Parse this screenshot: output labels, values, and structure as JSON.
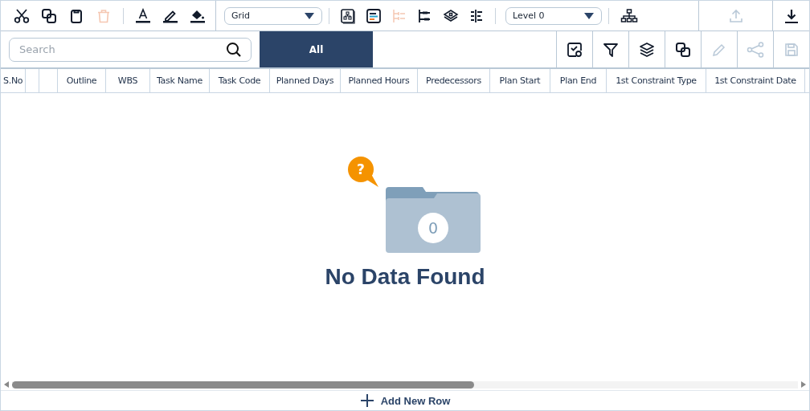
{
  "toolbar": {
    "edit_tools": [
      {
        "kind": "cut",
        "disabled": false
      },
      {
        "kind": "copy",
        "disabled": false
      },
      {
        "kind": "paste",
        "disabled": false
      },
      {
        "kind": "delete",
        "disabled": true
      }
    ],
    "format_tools": [
      {
        "kind": "font-color",
        "disabled": false
      },
      {
        "kind": "highlight",
        "disabled": false
      },
      {
        "kind": "fill",
        "disabled": false
      }
    ],
    "view_select": {
      "value": "Grid"
    },
    "view_tools": [
      {
        "kind": "org-card",
        "disabled": false
      },
      {
        "kind": "bars",
        "disabled": false
      },
      {
        "kind": "tree",
        "disabled": true
      },
      {
        "kind": "links",
        "disabled": false
      },
      {
        "kind": "layers",
        "disabled": false
      },
      {
        "kind": "indent",
        "disabled": false
      }
    ],
    "level_select": {
      "value": "Level 0"
    },
    "hierarchy": {
      "kind": "hierarchy",
      "disabled": false
    },
    "upload": {
      "kind": "upload",
      "disabled": true
    },
    "download": {
      "kind": "download",
      "disabled": false
    }
  },
  "search": {
    "placeholder": "Search"
  },
  "tabs": [
    {
      "label": "All",
      "selected": true
    }
  ],
  "actions": [
    {
      "kind": "view-check",
      "disabled": false
    },
    {
      "kind": "filter",
      "disabled": false
    },
    {
      "kind": "stack",
      "disabled": false
    },
    {
      "kind": "copy",
      "disabled": false
    },
    {
      "kind": "pencil",
      "disabled": true
    },
    {
      "kind": "share",
      "disabled": true
    },
    {
      "kind": "save",
      "disabled": true
    }
  ],
  "table": {
    "columns": [
      "S.No",
      "Outline",
      "WBS",
      "Task Name",
      "Task Code",
      "Planned Days",
      "Planned Hours",
      "Predecessors",
      "Plan Start",
      "Plan End",
      "1st Constraint Type",
      "1st Constraint Date"
    ]
  },
  "empty_state": {
    "badge": "?",
    "count": "0",
    "message": "No Data Found"
  },
  "add_row": {
    "label": "Add New Row"
  }
}
